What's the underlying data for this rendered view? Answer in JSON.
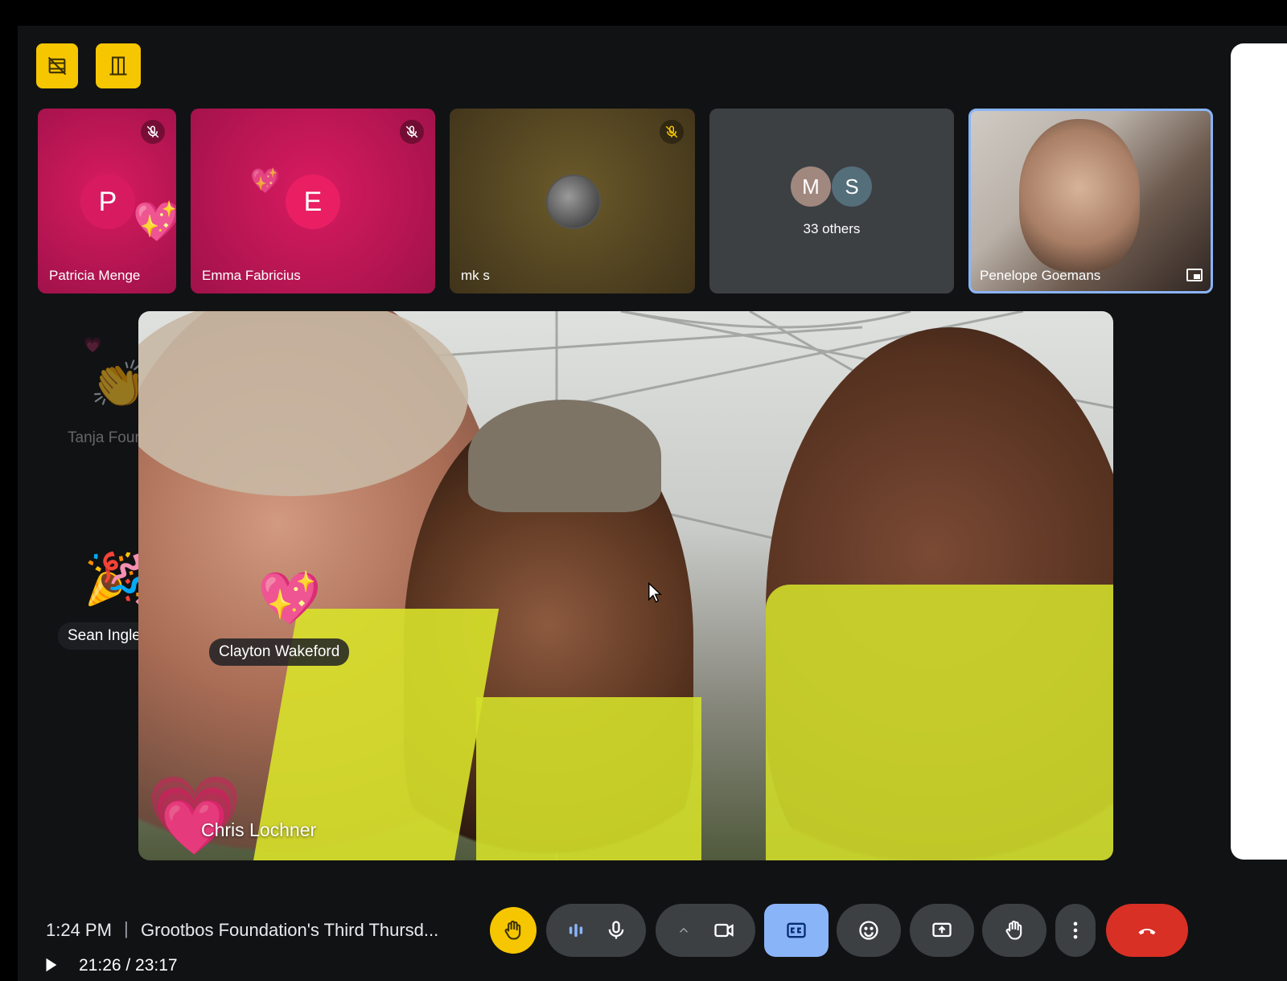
{
  "top_buttons": [
    {
      "icon": "film-off-icon"
    },
    {
      "icon": "door-exit-icon"
    }
  ],
  "tiles": [
    {
      "name": "Patricia Menge",
      "initial": "P",
      "muted": true
    },
    {
      "name": "Emma Fabricius",
      "initial": "E",
      "muted": true
    },
    {
      "name": "mk s",
      "muted": true
    },
    {
      "others_initials": [
        "M",
        "S"
      ],
      "others_label": "33 others"
    },
    {
      "name": "Penelope Goemans",
      "pinned_icon": "picture-in-picture-icon"
    }
  ],
  "stage": {
    "side_names": [
      "Tanja Fourie",
      "Sean Ingles"
    ],
    "reaction_labels": [
      "Clayton Wakeford"
    ],
    "main_speaker": "Chris Lochner",
    "emojis": {
      "sparkling_heart": "💖",
      "party_popper": "🎉",
      "clap": "👏",
      "heart": "💗"
    }
  },
  "bottom_bar": {
    "time": "1:24 PM",
    "separator": "|",
    "meeting_title": "Grootbos Foundation's Third Thursd...",
    "playback": {
      "current": "21:26",
      "total": "23:17",
      "display": "21:26 / 23:17"
    },
    "controls": [
      "hand-wave-icon",
      "audio-levels-icon",
      "microphone-icon",
      "chevron-up-icon",
      "camera-icon",
      "captions-icon",
      "emoji-icon",
      "present-screen-icon",
      "raise-hand-icon",
      "more-options-icon",
      "end-call-icon"
    ]
  },
  "colors": {
    "accent_yellow": "#f6c600",
    "tile_magenta": "#c2185b",
    "end_call_red": "#d93025",
    "captions_active": "#8ab4f8",
    "pinned_border": "#8ab4f8"
  }
}
